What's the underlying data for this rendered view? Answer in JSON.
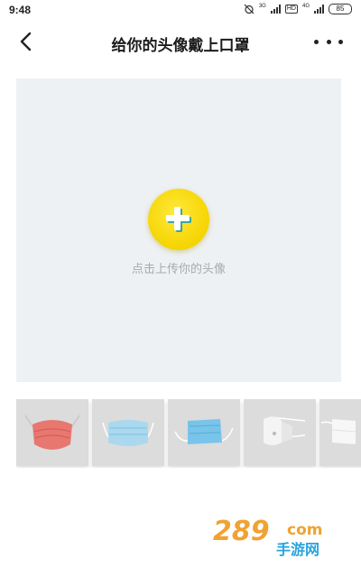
{
  "status_bar": {
    "time": "9:48",
    "network1": "3G",
    "network2": "4G",
    "hd": "HD",
    "battery": "85"
  },
  "header": {
    "title": "给你的头像戴上口罩"
  },
  "upload": {
    "hint": "点击上传你的头像"
  },
  "masks": [
    {
      "name": "red-mask",
      "color": "#e8776f"
    },
    {
      "name": "blue-surgical-mask",
      "color": "#a9d8ef"
    },
    {
      "name": "blue-medical-mask",
      "color": "#79c4ea"
    },
    {
      "name": "white-n95-mask",
      "color": "#f4f4f4"
    },
    {
      "name": "white-kn95-mask",
      "color": "#f7f7f7"
    }
  ],
  "watermark": {
    "number": "289",
    "domain": "com",
    "subtitle": "手游网"
  },
  "colors": {
    "accent_yellow": "#f5d400",
    "upload_bg": "#eef1f3",
    "hint_text": "#a9a9a9"
  }
}
